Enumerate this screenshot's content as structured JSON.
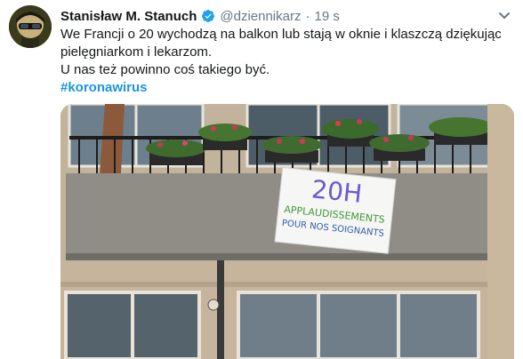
{
  "tweet": {
    "author_name": "Stanisław M. Stanuch",
    "handle": "@dziennikarz",
    "separator": "·",
    "time": "19 s",
    "text_line1": "We Francji o 20 wychodzą na balkon lub stają w oknie i klaszczą dziękując pielęgniarkom i lekarzom.",
    "text_line2": "U nas też powinno coś takiego być.",
    "hashtag": "#koronawirus"
  },
  "media": {
    "sign_line1": "20H",
    "sign_line2": "APPLAUDISSEMENTS",
    "sign_line3": "POUR NOS SOIGNANTS"
  },
  "colors": {
    "verified_badge": "#1da1f2",
    "hashtag": "#1b95e0",
    "secondary_text": "#657786"
  },
  "icons": {
    "verified": "verified-badge-icon",
    "caret": "chevron-down-icon"
  }
}
